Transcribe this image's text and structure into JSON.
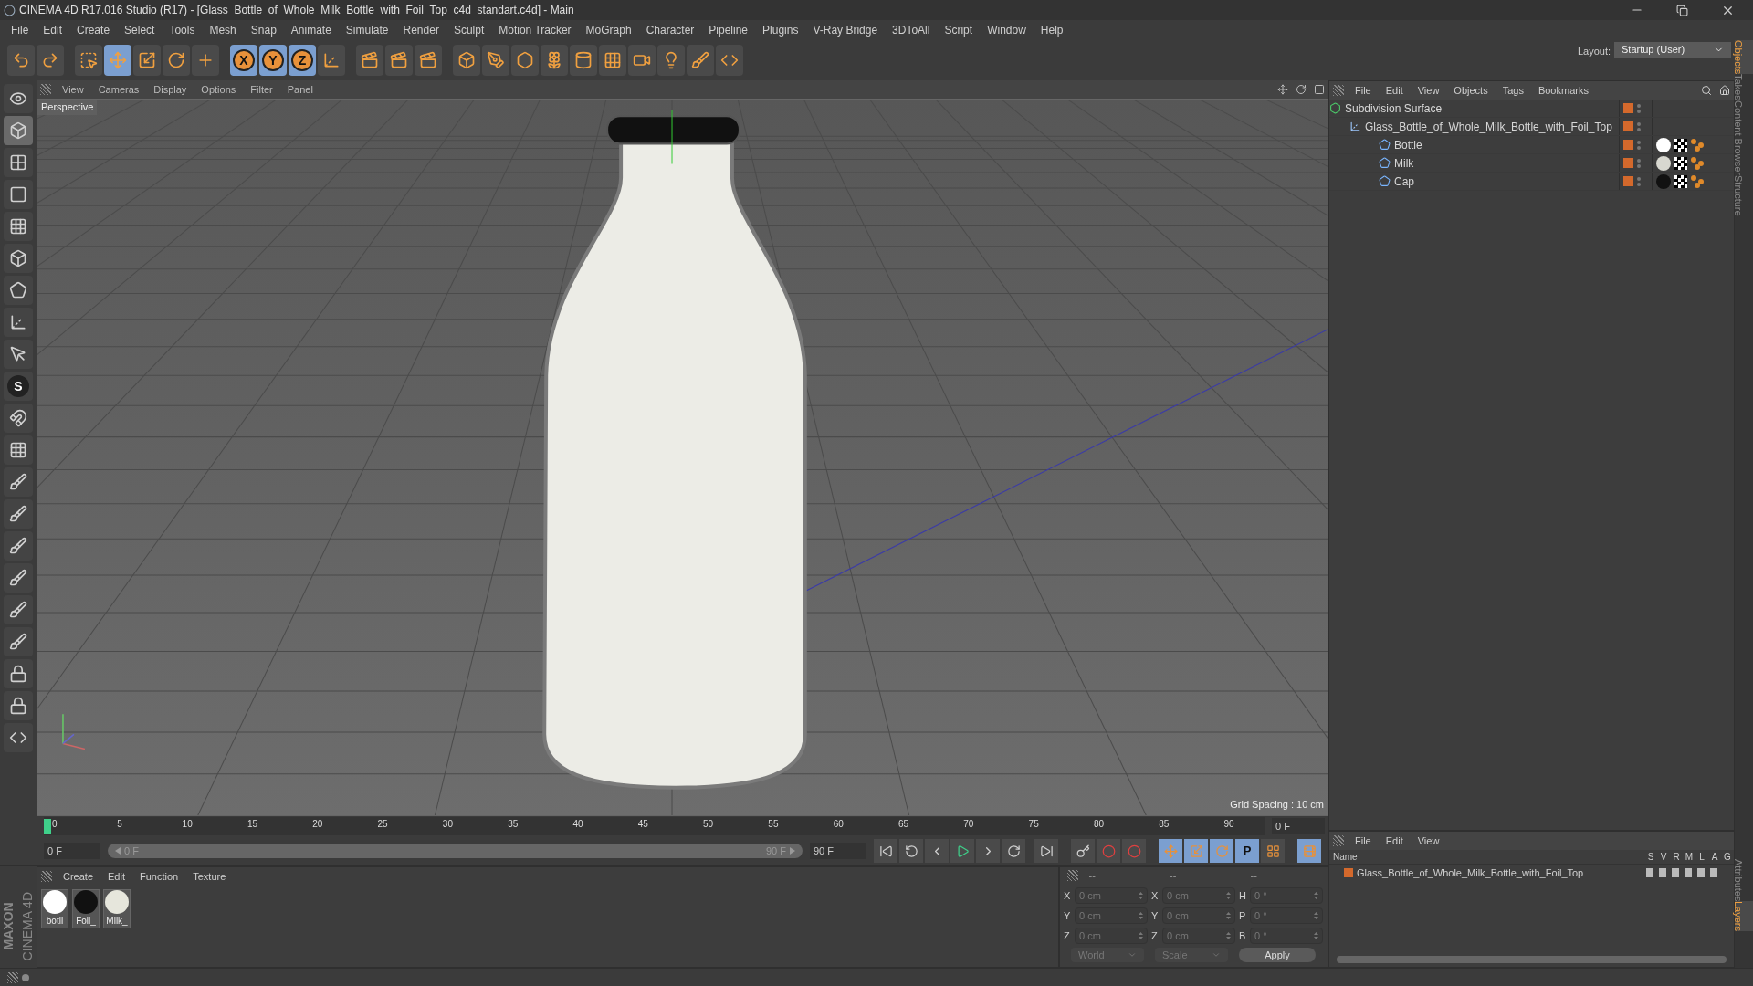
{
  "window": {
    "title": "CINEMA 4D R17.016 Studio (R17) - [Glass_Bottle_of_Whole_Milk_Bottle_with_Foil_Top_c4d_standart.c4d] - Main"
  },
  "menu_bar": [
    "File",
    "Edit",
    "Create",
    "Select",
    "Tools",
    "Mesh",
    "Snap",
    "Animate",
    "Simulate",
    "Render",
    "Sculpt",
    "Motion Tracker",
    "MoGraph",
    "Character",
    "Pipeline",
    "Plugins",
    "V-Ray Bridge",
    "3DToAll",
    "Script",
    "Window",
    "Help"
  ],
  "layout": {
    "label": "Layout:",
    "value": "Startup (User)"
  },
  "toolbar": [
    {
      "kind": "undo",
      "selected": false
    },
    {
      "kind": "redo",
      "selected": false
    },
    {
      "kind": "sep"
    },
    {
      "kind": "select",
      "selected": false
    },
    {
      "kind": "move",
      "selected": true
    },
    {
      "kind": "scale",
      "selected": false
    },
    {
      "kind": "rotate",
      "selected": false
    },
    {
      "kind": "add",
      "selected": false
    },
    {
      "kind": "sep"
    },
    {
      "kind": "axis",
      "label": "X",
      "selected": true
    },
    {
      "kind": "axis",
      "label": "Y",
      "selected": true
    },
    {
      "kind": "axis",
      "label": "Z",
      "selected": true
    },
    {
      "kind": "coords",
      "selected": false
    },
    {
      "kind": "sep"
    },
    {
      "kind": "render",
      "selected": false
    },
    {
      "kind": "render",
      "selected": false
    },
    {
      "kind": "render",
      "selected": false
    },
    {
      "kind": "sep"
    },
    {
      "kind": "cube",
      "selected": false
    },
    {
      "kind": "pen",
      "selected": false
    },
    {
      "kind": "subdiv",
      "selected": false
    },
    {
      "kind": "cloner",
      "selected": false
    },
    {
      "kind": "deformer",
      "selected": false
    },
    {
      "kind": "floor",
      "selected": false
    },
    {
      "kind": "camera",
      "selected": false
    },
    {
      "kind": "light",
      "selected": false
    },
    {
      "kind": "sketch",
      "selected": false
    },
    {
      "kind": "python",
      "selected": false
    }
  ],
  "left_tools": [
    {
      "kind": "view",
      "selected": false
    },
    {
      "kind": "model",
      "selected": true
    },
    {
      "kind": "texture",
      "selected": false
    },
    {
      "kind": "uv",
      "selected": false
    },
    {
      "kind": "points",
      "selected": false
    },
    {
      "kind": "edges",
      "selected": false
    },
    {
      "kind": "polygons",
      "selected": false
    },
    {
      "kind": "axis",
      "selected": false
    },
    {
      "kind": "tweak",
      "selected": false
    },
    {
      "kind": "snap",
      "label": "S",
      "selected": false
    },
    {
      "kind": "magnet",
      "selected": false
    },
    {
      "kind": "workplane",
      "selected": false
    },
    {
      "kind": "brush",
      "selected": false
    },
    {
      "kind": "brush",
      "selected": false
    },
    {
      "kind": "brush",
      "selected": false
    },
    {
      "kind": "brush",
      "selected": false
    },
    {
      "kind": "brush",
      "selected": false
    },
    {
      "kind": "brush",
      "selected": false
    },
    {
      "kind": "lock",
      "selected": false
    },
    {
      "kind": "lock",
      "selected": false
    },
    {
      "kind": "python",
      "selected": false
    }
  ],
  "viewport": {
    "menu": [
      "View",
      "Cameras",
      "Display",
      "Options",
      "Filter",
      "Panel"
    ],
    "label": "Perspective",
    "grid_spacing": "Grid Spacing : 10 cm"
  },
  "timeline": {
    "ticks": [
      "0",
      "5",
      "10",
      "15",
      "20",
      "25",
      "30",
      "35",
      "40",
      "45",
      "50",
      "55",
      "60",
      "65",
      "70",
      "75",
      "80",
      "85",
      "90"
    ],
    "current_frame": "0 F",
    "start": "0 F",
    "range_start": "0 F",
    "range_end": "90 F",
    "range_slider": {
      "level": 1
    },
    "end": "90 F",
    "key_label": "P"
  },
  "materials": {
    "menu": [
      "Create",
      "Edit",
      "Function",
      "Texture"
    ],
    "items": [
      {
        "name": "botll",
        "color": "#ffffff"
      },
      {
        "name": "Foil_",
        "color": "#111111"
      },
      {
        "name": "Milk_",
        "color": "#e6e6dc"
      }
    ]
  },
  "brand": {
    "maker": "MAXON",
    "product": "CINEMA 4D"
  },
  "coordinates": {
    "headers": [
      "--",
      "--",
      "--"
    ],
    "rows": [
      {
        "a": "X",
        "pos": "0 cm",
        "b": "X",
        "size": "0 cm",
        "c": "H",
        "rot": "0 °"
      },
      {
        "a": "Y",
        "pos": "0 cm",
        "b": "Y",
        "size": "0 cm",
        "c": "P",
        "rot": "0 °"
      },
      {
        "a": "Z",
        "pos": "0 cm",
        "b": "Z",
        "size": "0 cm",
        "c": "B",
        "rot": "0 °"
      }
    ],
    "space": "World",
    "mode": "Scale",
    "apply": "Apply"
  },
  "objects": {
    "menu": [
      "File",
      "Edit",
      "View",
      "Objects",
      "Tags",
      "Bookmarks"
    ],
    "tree": [
      {
        "name": "Subdivision Surface",
        "kind": "subdiv",
        "children": [
          {
            "name": "Glass_Bottle_of_Whole_Milk_Bottle_with_Foil_Top",
            "kind": "null",
            "children": [
              {
                "name": "Bottle",
                "kind": "mesh",
                "color": "#ffffff"
              },
              {
                "name": "Milk",
                "kind": "mesh",
                "color": "#d8d8d0"
              },
              {
                "name": "Cap",
                "kind": "mesh",
                "color": "#111111"
              }
            ]
          }
        ]
      }
    ]
  },
  "layers": {
    "menu": [
      "File",
      "Edit",
      "View"
    ],
    "columns": [
      "Name",
      "S",
      "V",
      "R",
      "M",
      "L",
      "A",
      "G"
    ],
    "rows": [
      {
        "name": "Glass_Bottle_of_Whole_Milk_Bottle_with_Foil_Top",
        "color": "#d4692c"
      }
    ]
  },
  "side_tabs_top": [
    {
      "label": "Objects",
      "selected": true
    },
    {
      "label": "Takes",
      "selected": false
    },
    {
      "label": "Content Browser",
      "selected": false
    },
    {
      "label": "Structure",
      "selected": false
    }
  ],
  "side_tabs_bottom": [
    {
      "label": "Attributes",
      "selected": false
    },
    {
      "label": "Layers",
      "selected": true
    }
  ]
}
